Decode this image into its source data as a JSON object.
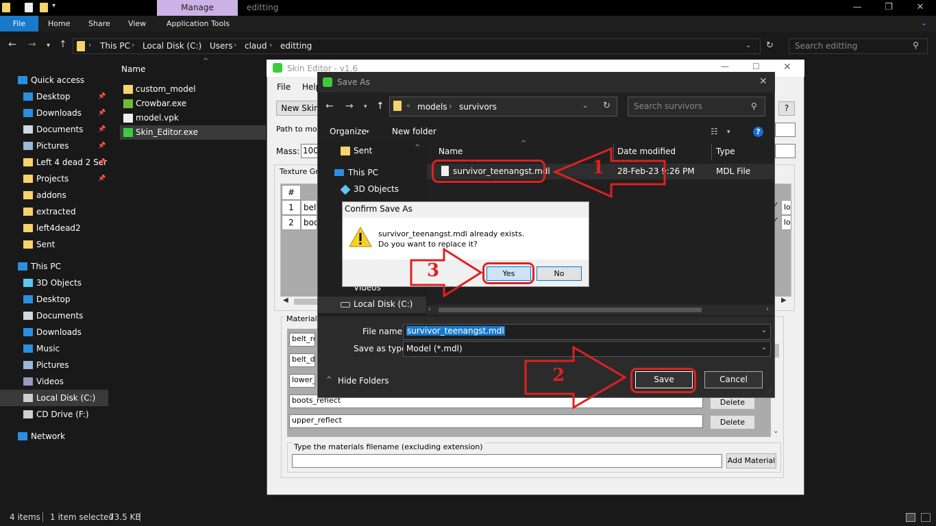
{
  "explorer": {
    "ribbon_context": "Manage",
    "window_title": "editting",
    "tabs": {
      "file": "File",
      "home": "Home",
      "share": "Share",
      "view": "View",
      "app_tools": "Application Tools"
    },
    "breadcrumb": [
      "This PC",
      "Local Disk (C:)",
      "Users",
      "claud",
      "editting"
    ],
    "search_placeholder": "Search editting",
    "column_name": "Name",
    "sidebar": [
      {
        "label": "Quick access",
        "icon": "star-icon",
        "pin": false
      },
      {
        "label": "Desktop",
        "icon": "desktop-icon",
        "pin": true
      },
      {
        "label": "Downloads",
        "icon": "download-icon",
        "pin": true
      },
      {
        "label": "Documents",
        "icon": "documents-icon",
        "pin": true
      },
      {
        "label": "Pictures",
        "icon": "pictures-icon",
        "pin": true
      },
      {
        "label": "Left 4 dead 2 Ser",
        "icon": "folder-icon",
        "pin": true
      },
      {
        "label": "Projects",
        "icon": "folder-icon",
        "pin": true
      },
      {
        "label": "addons",
        "icon": "folder-icon",
        "pin": false
      },
      {
        "label": "extracted",
        "icon": "folder-icon",
        "pin": false
      },
      {
        "label": "left4dead2",
        "icon": "folder-icon",
        "pin": false
      },
      {
        "label": "Sent",
        "icon": "folder-icon",
        "pin": false
      },
      {
        "label": "This PC",
        "icon": "pc-icon",
        "pin": false
      },
      {
        "label": "3D Objects",
        "icon": "3d-objects-icon",
        "pin": false
      },
      {
        "label": "Desktop",
        "icon": "desktop-icon",
        "pin": false
      },
      {
        "label": "Documents",
        "icon": "documents-icon",
        "pin": false
      },
      {
        "label": "Downloads",
        "icon": "download-icon",
        "pin": false
      },
      {
        "label": "Music",
        "icon": "music-icon",
        "pin": false
      },
      {
        "label": "Pictures",
        "icon": "pictures-icon",
        "pin": false
      },
      {
        "label": "Videos",
        "icon": "videos-icon",
        "pin": false
      },
      {
        "label": "Local Disk (C:)",
        "icon": "drive-icon",
        "pin": false
      },
      {
        "label": "CD Drive (F:)",
        "icon": "cd-drive-icon",
        "pin": false
      },
      {
        "label": "Network",
        "icon": "network-icon",
        "pin": false
      }
    ],
    "files": [
      {
        "name": "custom_model",
        "icon": "folder-icon"
      },
      {
        "name": "Crowbar.exe",
        "icon": "crowbar-icon"
      },
      {
        "name": "model.vpk",
        "icon": "file-icon"
      },
      {
        "name": "Skin_Editor.exe",
        "icon": "skin-editor-icon"
      }
    ],
    "status": {
      "items": "4 items",
      "selected": "1 item selected",
      "size": "73.5 KB"
    }
  },
  "skin_editor": {
    "title": "Skin Editor - v1.6",
    "menu": {
      "file": "File",
      "help": "Help"
    },
    "new_skin": "New Skin",
    "help_btn": "?",
    "path_label": "Path to model",
    "mass_label": "Mass:",
    "mass_value": "100",
    "texture_group": "Texture Gro",
    "grid_header": "#",
    "grid_rows": [
      {
        "n": "1",
        "v": "belt_",
        "t": "lo"
      },
      {
        "n": "2",
        "v": "body",
        "t": "lo"
      }
    ],
    "material_group": "Material N",
    "materials": [
      "belt_refl",
      "belt_diff",
      "lower_re",
      "boots_reflect",
      "upper_reflect"
    ],
    "delete": "Delete",
    "type_label": "Type the materials filename (excluding extension)",
    "add_material": "Add Material"
  },
  "save_as": {
    "title": "Save As",
    "path": [
      "models",
      "survivors"
    ],
    "search_placeholder": "Search survivors",
    "organize": "Organize",
    "new_folder": "New folder",
    "tree": [
      {
        "label": "Sent",
        "icon": "folder-icon"
      },
      {
        "label": "This PC",
        "icon": "pc-icon"
      },
      {
        "label": "3D Objects",
        "icon": "3d-objects-icon"
      },
      {
        "label": "Videos",
        "icon": "videos-icon"
      },
      {
        "label": "Local Disk (C:)",
        "icon": "drive-icon"
      }
    ],
    "columns": {
      "name": "Name",
      "date": "Date modified",
      "type": "Type"
    },
    "file": {
      "name": "survivor_teenangst.mdl",
      "date": "28-Feb-23 9:26 PM",
      "type": "MDL File"
    },
    "file_name_label": "File name:",
    "file_name_value": "survivor_teenangst.mdl",
    "save_type_label": "Save as type:",
    "save_type_value": "Model (*.mdl)",
    "hide_folders": "Hide Folders",
    "save": "Save",
    "cancel": "Cancel"
  },
  "confirm": {
    "title": "Confirm Save As",
    "line1": "survivor_teenangst.mdl already exists.",
    "line2": "Do you want to replace it?",
    "yes": "Yes",
    "no": "No"
  },
  "annotations": {
    "n1": "1",
    "n2": "2",
    "n3": "3"
  },
  "colors": {
    "annotation_red": "#e02020",
    "file_tab": "#1979ca",
    "manage_tab": "#ccb2e6",
    "folder": "#f6d36b"
  }
}
